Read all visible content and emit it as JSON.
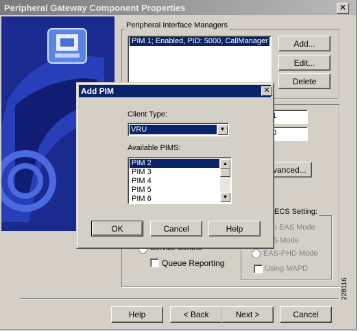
{
  "window": {
    "title": "Peripheral Gateway Component Properties",
    "close_glyph": "✕"
  },
  "pim_group": {
    "label": "Peripheral Interface Managers",
    "items": [
      "PIM 1; Enabled, PID: 5000, CallManager"
    ],
    "add_label": "Add...",
    "edit_label": "Edit...",
    "delete_label": "Delete"
  },
  "background_fields": {
    "field1_value": "1",
    "field2_value": "0",
    "advanced_label": "Advanced..."
  },
  "ecs_group": {
    "label_fragment": "ECS Setting:",
    "radio1_label": "n EAS Mode",
    "radio2_label": "S Mode",
    "radio3_label": "EAS-PHD Mode",
    "mapd_label": "Using MAPD"
  },
  "service_control_label": "Service Control",
  "queue_reporting_label": "Queue Reporting",
  "footer": {
    "help_label": "Help",
    "back_label": "< Back",
    "next_label": "Next >",
    "cancel_label": "Cancel"
  },
  "dialog": {
    "title": "Add PIM",
    "client_type_label": "Client Type:",
    "client_type_value": "VRU",
    "available_pims_label": "Available PIMS:",
    "available_pims": [
      "PIM 2",
      "PIM 3",
      "PIM 4",
      "PIM 5",
      "PIM 6"
    ],
    "selected_pim": "PIM 2",
    "ok_label": "OK",
    "cancel_label": "Cancel",
    "help_label": "Help"
  },
  "figure_number": "228116",
  "colors": {
    "selection": "#0a246a",
    "side_panel": "#1a2a8f",
    "dialog_face": "#d4d0c8"
  }
}
